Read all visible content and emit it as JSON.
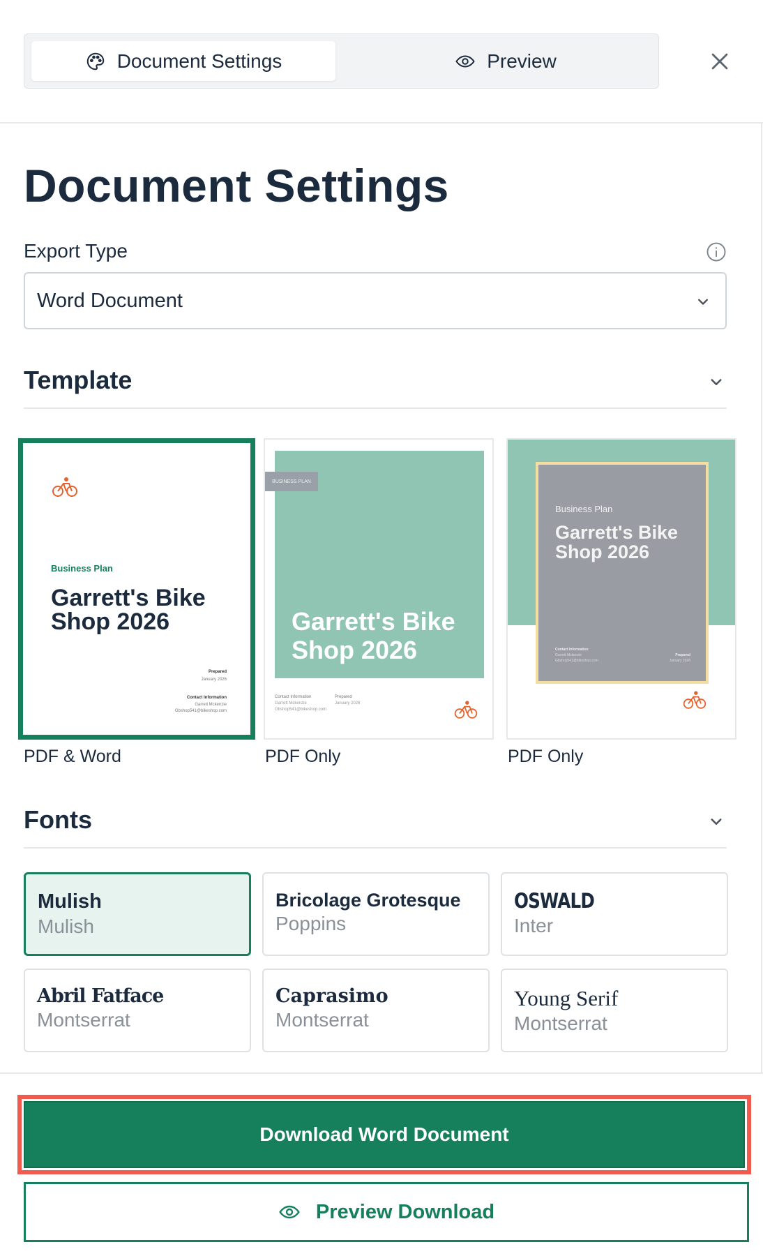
{
  "tabs": {
    "settings_label": "Document Settings",
    "preview_label": "Preview"
  },
  "page": {
    "title": "Document Settings"
  },
  "export": {
    "label": "Export Type",
    "selected": "Word Document"
  },
  "template": {
    "title": "Template",
    "items": [
      {
        "caption": "PDF & Word",
        "kicker": "Business Plan",
        "doc_title": "Garrett's Bike Shop 2026",
        "prepared_label": "Prepared",
        "prepared_date": "January 2026",
        "contact_label": "Contact Information",
        "contact_name": "Garrett Mckenzie",
        "contact_email": "Gbshop541@bikeshop.com"
      },
      {
        "caption": "PDF Only",
        "tag": "BUSINESS PLAN",
        "doc_title": "Garrett's Bike Shop 2026",
        "contact_label": "Contact Information",
        "contact_name": "Garrett Mckenzie",
        "contact_email": "Gbshop541@bikeshop.com",
        "prepared_label": "Prepared",
        "prepared_date": "January 2026"
      },
      {
        "caption": "PDF Only",
        "kicker": "Business Plan",
        "doc_title": "Garrett's Bike Shop 2026",
        "contact_label": "Contact Information",
        "contact_name": "Garrett Mckenzie",
        "contact_email": "Gbshop541@bikeshop.com",
        "prepared_label": "Prepared",
        "prepared_date": "January 2026"
      }
    ]
  },
  "fonts": {
    "title": "Fonts",
    "items": [
      {
        "primary": "Mulish",
        "secondary": "Mulish",
        "selected": true
      },
      {
        "primary": "Bricolage Grotesque",
        "secondary": "Poppins",
        "selected": false
      },
      {
        "primary": "OSWALD",
        "secondary": "Inter",
        "selected": false
      },
      {
        "primary": "Abril Fatface",
        "secondary": "Montserrat",
        "selected": false
      },
      {
        "primary": "Caprasimo",
        "secondary": "Montserrat",
        "selected": false
      },
      {
        "primary": "Young Serif",
        "secondary": "Montserrat",
        "selected": false
      }
    ]
  },
  "actions": {
    "download_label": "Download Word Document",
    "preview_label": "Preview Download"
  },
  "colors": {
    "accent": "#15805b",
    "template_green": "#8fc5b2",
    "highlight": "#f05a4f"
  },
  "icons": {
    "settings_tab": "palette-icon",
    "preview_tab": "eye-icon",
    "close": "close-icon",
    "info": "info-icon",
    "dropdown": "chevron-down-icon",
    "logo": "bicycle-icon"
  }
}
